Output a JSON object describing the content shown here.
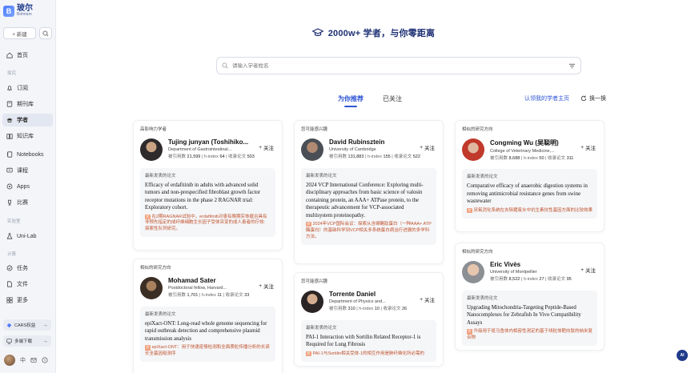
{
  "brand": {
    "name_cn": "玻尔",
    "name_en": "Bohrium",
    "logo_letter": "B"
  },
  "sidebar": {
    "new_label": "+ 新建",
    "nav": [
      {
        "label": "首页",
        "icon": "home-icon"
      },
      {
        "label": "订阅",
        "icon": "bell-icon"
      },
      {
        "label": "期刊库",
        "icon": "journal-icon"
      },
      {
        "label": "学者",
        "icon": "scholar-icon"
      },
      {
        "label": "知识库",
        "icon": "knowledge-icon"
      },
      {
        "label": "Notebooks",
        "icon": "notebook-icon"
      },
      {
        "label": "课程",
        "icon": "course-icon"
      },
      {
        "label": "Apps",
        "icon": "apps-icon"
      },
      {
        "label": "比赛",
        "icon": "trophy-icon"
      },
      {
        "label": "Uni-Lab",
        "icon": "lab-icon"
      },
      {
        "label": "任务",
        "icon": "task-icon"
      },
      {
        "label": "文件",
        "icon": "file-icon"
      },
      {
        "label": "更多",
        "icon": "more-icon"
      }
    ],
    "sections": [
      "探究",
      "实验室",
      "计算"
    ],
    "cards_btn": "CARS权益",
    "download_btn": "多端下载",
    "lang": "中",
    "active_index": 3
  },
  "main": {
    "headline": "2000w+ 学者，与你零距离",
    "search_placeholder": "请输入学者姓名",
    "tabs": [
      {
        "label": "为你推荐",
        "active": true
      },
      {
        "label": "已关注",
        "active": false
      }
    ],
    "claim_link": "认领我的学者主页",
    "refresh_label": "换一换",
    "follow_label": "关注",
    "paper_tag": "最新发表的论文",
    "stat_labels": {
      "citations": "被引用数",
      "hindex": "h-index",
      "papers": "收录论文"
    }
  },
  "scholars": [
    {
      "tag": "高影响力学者",
      "name": "Tujing junyan (Toshihiko...",
      "affiliation": "Department of Gastrointestinal...",
      "citations": "21,599",
      "hindex": "64",
      "papers": "503",
      "paper_title": "Efficacy of erdafitinib in adults with advanced solid tumors and non-prespecified fibroblast growth factor receptor mutations in the phase 2 RAGNAR trial: Exploratory cohort.",
      "paper_summary": "在2期RAGNAR试验中，erdafitinib对患有晚期实体瘤且具有非预先指定的成纤维细胞生长因子受体突变的成人患者的疗效: 探索性队列研究。"
    },
    {
      "tag": "相似的研究方向",
      "name": "Mohamad Sater",
      "affiliation": "Postdoctoral fellow, Harvard...",
      "citations": "1,701",
      "hindex": "11",
      "papers": "33",
      "paper_title": "epiXact-ONT: Long-read whole genome sequencing for rapid outbreak detection and comprehensive plasmid transmission analysis",
      "paper_summary": "epiXact-ONT：用于快速疫情检测和全面质粒传播分析的长读长全基因组测序"
    },
    {
      "tag": "您可能感兴趣",
      "name": "David Rubinsztein",
      "affiliation": "University of Cambridge",
      "citations": "131,883",
      "hindex": "155",
      "papers": "522",
      "paper_title": "2024 VCP International Conference: Exploring multi-disciplinary approaches from basic science of valosin containing protein, an AAA+ ATPase protein, to the therapeutic advancement for VCP-associated multisystem proteinopathy.",
      "paper_summary": "2024年VCP国际会议：探索从含缬酪肽蛋白（一种AAA+ ATP酶蛋白）的基础科学到VCP相关多系统蛋白病治疗进展的多学科方法。"
    },
    {
      "tag": "您可能感兴趣",
      "name": "Torrente Daniel",
      "affiliation": "Department of Physics and...",
      "citations": "310",
      "hindex": "10",
      "papers": "26",
      "paper_title": "PAI-1 Interaction with Sortilin Related Receptor-1 is Required for Lung Fibrosis",
      "paper_summary": "PAI-1与Sortilin相关受体-1的相互作用是肺纤维化所必需的"
    },
    {
      "tag": "相似的研究方向",
      "name": "Congming Wu (吴聪明)",
      "affiliation": "College of Veterinary Medicine,...",
      "citations": "8,688",
      "hindex": "50",
      "papers": "311",
      "paper_title": "Comparative efficacy of anaerobic digestion systems in removing antimicrobial resistance genes from swine wastewater",
      "paper_summary": "厌氧消化系统在去除猪废水中抗生素抗性基因方面的比较效果"
    },
    {
      "tag": "相似的研究方向",
      "name": "Eric Vivès",
      "affiliation": "University of Montpellier",
      "citations": "8,522",
      "hindex": "27",
      "papers": "95",
      "paper_title": "Upgrading Mitochondria-Targeting Peptide-Based Nanocomplexes for Zebrafish In Vivo Compatibility Assays",
      "paper_summary": "升级用于斑马鱼体内相容性测定的基于线粒体靶向肽的纳米复合物"
    }
  ],
  "ai_label": "AI"
}
